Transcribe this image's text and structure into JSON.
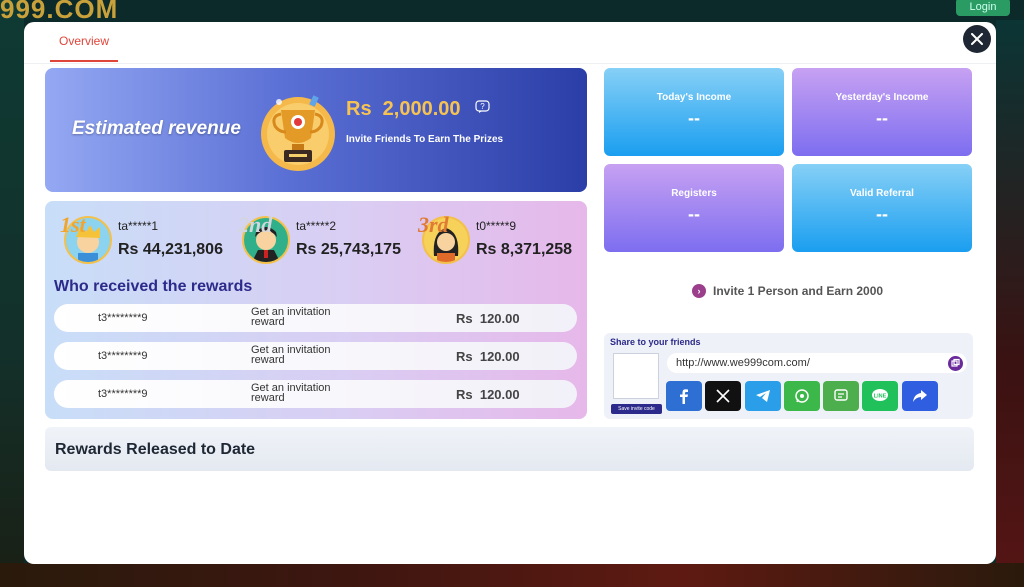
{
  "background": {
    "logo_text": "999.COM",
    "login_label": "Login"
  },
  "tabs": [
    {
      "label": "Overview"
    }
  ],
  "banner": {
    "title": "Estimated revenue",
    "amount": "Rs  2,000.00",
    "subtitle": "Invite Friends To Earn The Prizes"
  },
  "leaderboard": [
    {
      "rank": "1st",
      "medal_color": "#f0a531",
      "user": "ta*****1",
      "amount": "Rs 44,231,806"
    },
    {
      "rank": "2nd",
      "medal_color": "#d3d6de",
      "user": "ta*****2",
      "amount": "Rs 25,743,175"
    },
    {
      "rank": "3rd",
      "medal_color": "#e07a35",
      "user": "t0*****9",
      "amount": "Rs 8,371,258"
    }
  ],
  "rewards": {
    "title": "Who received the rewards",
    "rows": [
      {
        "user": "t3********9",
        "desc": "Get an invitation reward",
        "amount": "Rs  120.00"
      },
      {
        "user": "t3********9",
        "desc": "Get an invitation reward",
        "amount": "Rs  120.00"
      },
      {
        "user": "t3********9",
        "desc": "Get an invitation reward",
        "amount": "Rs  120.00"
      }
    ]
  },
  "released": {
    "title": "Rewards Released to Date"
  },
  "stats": [
    {
      "label": "Today's Income",
      "value": "--"
    },
    {
      "label": "Yesterday's Income",
      "value": "--"
    },
    {
      "label": "Registers",
      "value": "--"
    },
    {
      "label": "Valid Referral",
      "value": "--"
    }
  ],
  "invite": {
    "text": "Invite 1 Person and Earn 2000"
  },
  "share": {
    "title": "Share to your friends",
    "save_code_label": "Save invite code",
    "url": "http://www.we999com.com/",
    "networks": [
      {
        "icon": "facebook-icon",
        "color": "#2d6fd3"
      },
      {
        "icon": "x-twitter-icon",
        "color": "#111111"
      },
      {
        "icon": "telegram-icon",
        "color": "#2a9ee8"
      },
      {
        "icon": "whatsapp-icon",
        "color": "#3cb84a"
      },
      {
        "icon": "sms-icon",
        "color": "#4cae4c"
      },
      {
        "icon": "line-icon",
        "color": "#20c15a"
      },
      {
        "icon": "share-icon",
        "color": "#2f5ee0"
      }
    ]
  },
  "colors": {
    "accent": "#e0453b",
    "title_navy": "#2c2a8a",
    "close_button": "#1e2733"
  }
}
